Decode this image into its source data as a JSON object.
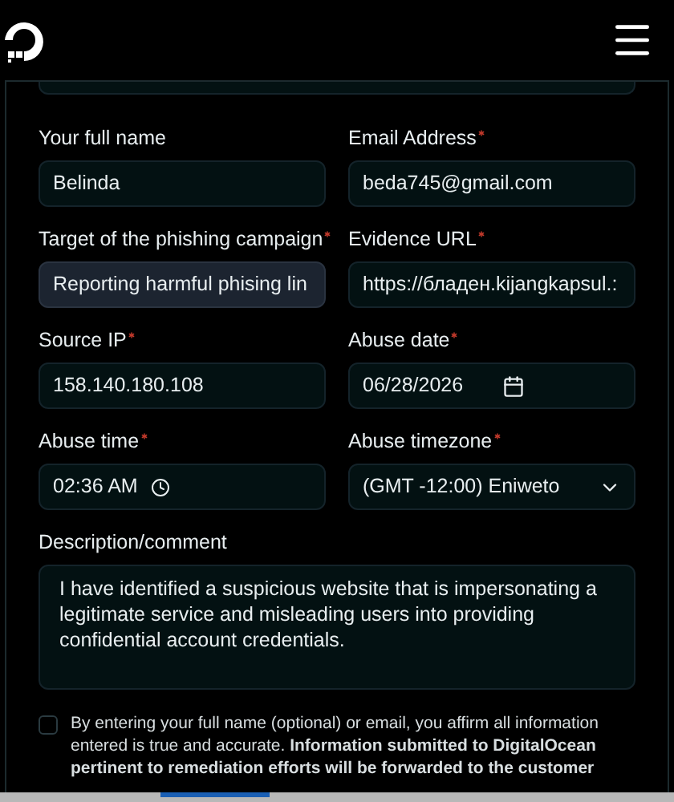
{
  "fields": [
    {
      "label": "Your full name",
      "required": false,
      "kind": "text",
      "value": "Belinda",
      "highlighted": false
    },
    {
      "label": "Email Address",
      "required": true,
      "kind": "text",
      "value": "beda745@gmail.com",
      "highlighted": false
    },
    {
      "label": "Target of the phishing campaign",
      "required": true,
      "kind": "text",
      "value": "Reporting harmful phising lin",
      "highlighted": true
    },
    {
      "label": "Evidence URL",
      "required": true,
      "kind": "text",
      "value": "https://бладен.kijangkapsul.:",
      "highlighted": false
    },
    {
      "label": "Source IP",
      "required": true,
      "kind": "text",
      "value": "158.140.180.108",
      "highlighted": false
    },
    {
      "label": "Abuse date",
      "required": true,
      "kind": "date",
      "value": "06/28/2026",
      "highlighted": false
    },
    {
      "label": "Abuse time",
      "required": true,
      "kind": "time",
      "value": "02:36  AM",
      "highlighted": false
    },
    {
      "label": "Abuse timezone",
      "required": true,
      "kind": "select",
      "value": "(GMT -12:00) Eniweto",
      "highlighted": false
    }
  ],
  "description": {
    "label": "Description/comment",
    "value": "I have identified a suspicious website that is impersonating a legitimate service and misleading users into providing confidential account credentials."
  },
  "consent": {
    "checked": false,
    "text": "By entering your full name (optional) or email, you affirm all information entered is true and accurate. **Information submitted to DigitalOcean pertinent to remediation efforts will be forwarded to the customer**"
  }
}
